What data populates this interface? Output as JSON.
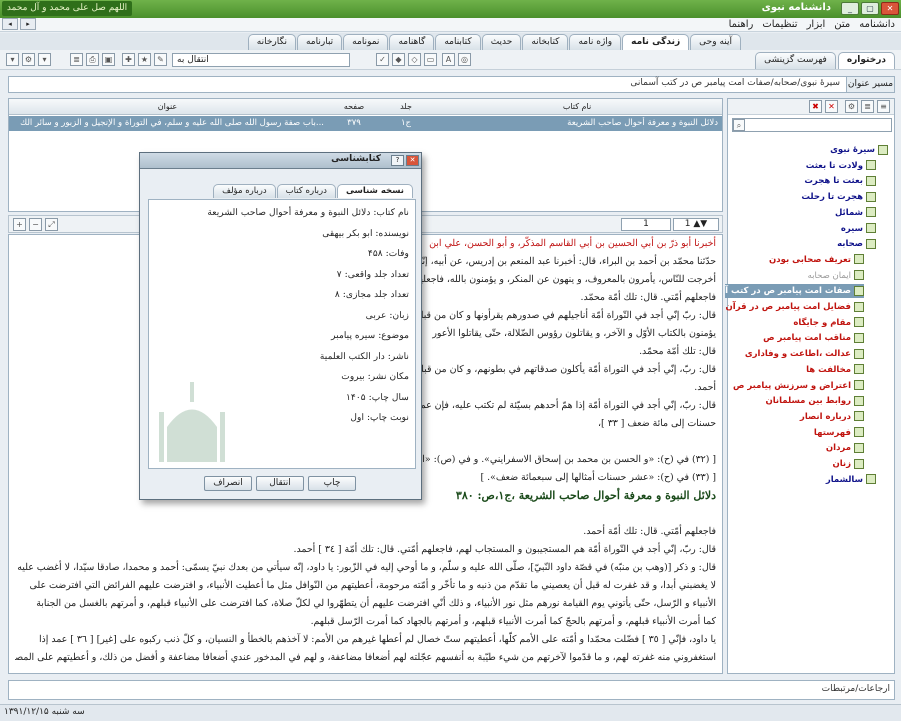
{
  "window": {
    "title": "دانشنامه نبوی",
    "logo_text": "اللهم صل علی محمد و آل محمد"
  },
  "menu": [
    "دانشنامه",
    "متن",
    "ابزار",
    "تنظیمات",
    "راهنما"
  ],
  "main_tabs": [
    "آینه وحی",
    "زندگی نامه",
    "واژه نامه",
    "کتابخانه",
    "حدیث",
    "کتابنامه",
    "گاهنامه",
    "نمونامه",
    "تبارنامه",
    "نگارخانه"
  ],
  "side_tabs": [
    "درختواره",
    "فهرست گزینشی"
  ],
  "toolbar": {
    "transfer_label": "انتقال به"
  },
  "path": {
    "label": "مسیر عنوان",
    "value": "سیرهٔ نبوی/صحابه/صفات امت پیامبر ص در کتب آسمانی"
  },
  "results": {
    "columns": [
      "نام کتاب",
      "جلد",
      "صفحه",
      "عنوان"
    ],
    "rows": [
      {
        "book": "دلائل النبوة و معرفة أحوال صاحب الشريعة",
        "volume": "ج١",
        "page": "٣٧٩",
        "title": "باب صفة رسول الله صلى الله عليه و سلم، في التوراة و الإنجيل و الزبور و سائر الك..."
      }
    ]
  },
  "reader": {
    "page_number": "1",
    "lines": [
      {
        "text": "أخبرنا أبو ذرّ بن أبي الحسين بن أبي القاسم المذكّر، و أبو الحسن، علي ابن",
        "style": "red"
      },
      {
        "text": "حدّثنا محمّد بن أحمد بن البراء، قال: أخبرنا عبد المنعم بن إدريس، عن أبيه، إنّي أجد في التوراة أمّة، خير أمّة",
        "style": ""
      },
      {
        "text": "أخرجت للنّاس، يأمرون بالمعروف، و ينهون عن المنكر، و يؤمنون بالله، فاجعلهم أمّتي. من الأمم، السّابقون يوم القيامة،",
        "style": ""
      },
      {
        "text": "فاجعلهم أمّتي. قال: تلك أمّة محمّد.",
        "style": ""
      },
      {
        "text": "قال: ربّ إنّي أجد في التّوراة أمّة أناجيلهم في صدورهم يقرأونها و كان من قبلهم. قال ربّ، إنّي أجد في التّوراة أمّة",
        "style": ""
      },
      {
        "text": "يؤمنون بالكتاب الأوّل و الآخر، و يقاتلون رؤوس الضّلالة، حتّى يقاتلوا الأعور",
        "style": ""
      },
      {
        "text": "قال: تلك أمّة محمّد.",
        "style": ""
      },
      {
        "text": "قال: ربّ، إنّي أجد في التوراة أمّة يأكلون صدقاتهم في بطونهم، و كان من قبلهم. النّار، فاجعلهم أمّتي. قال: تلك أمّة",
        "style": ""
      },
      {
        "text": "أحمد.",
        "style": ""
      },
      {
        "text": "قال: ربّ، إنّي أجد في التوراة أمّة إذا همّ أحدهم بسيّئة لم تكتب عليه، فإن عملها كتبت عليه سيّئة واحدة. حسنة، فإن عملها كتبت له عشر",
        "style": ""
      },
      {
        "text": "حسنات إلى مائة ضعف [ ٣٣ ]،",
        "style": ""
      },
      {
        "text": "",
        "style": ""
      },
      {
        "text": "[ (٣٢) في (ح): «و الحسن بن محمد بن إسحاق الاسفرايني». و في (ص): «الحسن بن",
        "style": ""
      },
      {
        "text": "[ (٣٣) في (ح): «عشر حسنات أمثالها إلى سبعمائة ضعف». ]",
        "style": ""
      },
      {
        "text": "دلائل النبوة و معرفة أحوال صاحب الشريعة ،ج١،ص: ٣٨٠",
        "style": "head"
      },
      {
        "text": "",
        "style": ""
      },
      {
        "text": "فاجعلهم أمّتي. قال: تلك أمّة أحمد.",
        "style": ""
      },
      {
        "text": "قال: ربّ، إنّي أجد في التّوراة أمّة هم المستجيبون و المستجاب لهم، فاجعلهم أمّتي. قال: تلك أمّة [ ٣٤ ] أحمد.",
        "style": ""
      },
      {
        "text": "قال: و ذكر [(وهب بن منبّه) في قصّة داود النّبيّ]، صلّى الله عليه و سلّم، و ما أوحي إليه في الزّبور: يا داود، إنّه سيأتي من بعدك نبيّ يسمّى: أحمد و محمدا، صادقا سيّدا، لا أغضب عليه أبدا، و",
        "style": ""
      },
      {
        "text": "لا يغضبني أبدا، و قد غفرت له قبل أن يعصيني ما تقدّم من ذنبه و ما تأخّر و أمّته مرحومة، أعطيتهم من النّوافل مثل ما أعطيت الأنبياء، و افترضت عليهم الفرائض التي افترضت على",
        "style": ""
      },
      {
        "text": "الأنبياء و الرّسل، حتّى يأتوني يوم القيامة نورهم مثل نور الأنبياء، و ذلك أنّي افترضت عليهم أن يتطهّروا لي لكلّ صلاة، كما افترضت على الأنبياء قبلهم، و أمرتهم بالغسل من الجنابة",
        "style": ""
      },
      {
        "text": "كما أمرت الأنبياء قبلهم، و أمرتهم بالحجّ كما أمرت الأنبياء قبلهم، و أمرتهم بالجهاد كما أمرت الرّسل قبلهم.",
        "style": ""
      },
      {
        "text": "يا داود، فإنّي [ ٣٥ ] فضّلت محمّدا و أمّته على الأمم كلّها، أعطيتهم ستّ خصال لم أعطها غيرهم من الأمم: لا آخذهم بالخطأ و النسيان، و كلّ ذنب ركبوه على [غير] [ ٣٦ ] عمد إذا",
        "style": ""
      },
      {
        "text": "استغفروني منه غفرته لهم، و ما قدّموا لآخرتهم من شي‌ء طيّبة به أنفسهم عجّلته لهم أضعافا مضاعفة، و لهم في المدخور عندي أضعافا مضاعفة و أفضل من ذلك، و أعطيتهم على المصائب",
        "style": ""
      }
    ]
  },
  "tree": [
    {
      "label": "سیرهٔ نبوی",
      "style": "",
      "depth": 0
    },
    {
      "label": "ولادت تا بعثت",
      "style": "",
      "depth": 1
    },
    {
      "label": "بعثت تا هجرت",
      "style": "",
      "depth": 1
    },
    {
      "label": "هجرت تا رحلت",
      "style": "",
      "depth": 1
    },
    {
      "label": "شمائل",
      "style": "",
      "depth": 1
    },
    {
      "label": "سیره",
      "style": "",
      "depth": 1
    },
    {
      "label": "صحابه",
      "style": "",
      "depth": 1
    },
    {
      "label": "تعریف صحابی بودن",
      "style": "red",
      "depth": 2
    },
    {
      "label": "ایمان صحابه",
      "style": "gray",
      "depth": 2
    },
    {
      "label": "صفات امت پیامبر ص در کتب آ",
      "style": "sel",
      "depth": 2
    },
    {
      "label": "فضایل امت پیامبر ص در قرآن",
      "style": "red",
      "depth": 2
    },
    {
      "label": "مقام و جایگاه",
      "style": "red",
      "depth": 2
    },
    {
      "label": "مناقب امت پیامبر ص",
      "style": "red",
      "depth": 2
    },
    {
      "label": "عدالت ،اطاعت و وفاداری",
      "style": "red",
      "depth": 2
    },
    {
      "label": "مخالفت ها",
      "style": "red",
      "depth": 2
    },
    {
      "label": "اعتراض و سرزنش پیامبر ص",
      "style": "red",
      "depth": 2
    },
    {
      "label": "روابط بین مسلمانان",
      "style": "red",
      "depth": 2
    },
    {
      "label": "درباره انصار",
      "style": "red",
      "depth": 2
    },
    {
      "label": "فهرستها",
      "style": "red",
      "depth": 2
    },
    {
      "label": "مردان",
      "style": "red",
      "depth": 2
    },
    {
      "label": "زنان",
      "style": "red",
      "depth": 2
    },
    {
      "label": "سالشمار",
      "style": "",
      "depth": 1
    }
  ],
  "bottom": {
    "label": "ارجاعات/مرتبطات"
  },
  "status": {
    "date": "سه شنبه ۱۳۹۱/۱۲/۱۵"
  },
  "dialog": {
    "title": "کتابشناسی",
    "tabs": [
      "نسخه شناسی",
      "درباره کتاب",
      "درباره مؤلف"
    ],
    "lines": [
      "نام کتاب: دلائل النبوة و معرفة أحوال صاحب الشريعة",
      "نویسنده: ابو بكر بيهقى",
      "وفات: ۴۵۸",
      "تعداد جلد واقعی: ۷",
      "تعداد جلد مجازی: ۸",
      "زبان: عربى",
      "موضوع: سيره پيامبر",
      "ناشر: دار الكتب العلمية",
      "مكان نشر: بيروت",
      "سال چاپ: ۱۴۰۵",
      "نوبت چاپ: اول"
    ],
    "buttons": [
      "چاپ",
      "انتقال",
      "انصراف"
    ]
  }
}
